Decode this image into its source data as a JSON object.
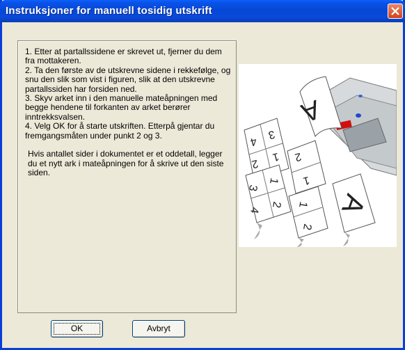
{
  "window": {
    "title": "Instruksjoner for manuell tosidig utskrift"
  },
  "instructions": {
    "step1": "1. Etter at partallssidene er skrevet ut, fjerner du dem fra mottakeren.",
    "step2": "2. Ta den første av de utskrevne sidene i rekkefølge, og snu den slik som vist i figuren, slik at den utskrevne partallssiden har forsiden ned.",
    "step3": "3. Skyv arket inn i den manuelle mateåpningen med begge hendene til forkanten av arket berører inntrekksvalsen.",
    "step4": "4. Velg OK for å starte utskriften. Etterpå gjentar du fremgangsmåten under punkt 2 og 3.",
    "note": "Hvis antallet sider i dokumentet er et oddetall, legger du et nytt ark i mateåpningen for å skrive ut den siste siden."
  },
  "buttons": {
    "ok": "OK",
    "cancel": "Avbryt"
  }
}
